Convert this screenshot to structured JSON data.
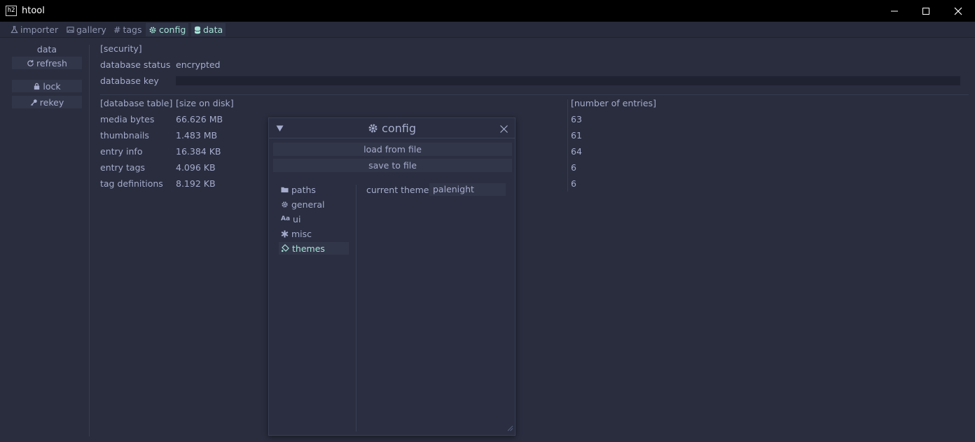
{
  "window": {
    "icon_text": "h2",
    "title": "htool"
  },
  "tabs": [
    {
      "label": "importer",
      "icon": "flask-icon"
    },
    {
      "label": "gallery",
      "icon": "image-icon"
    },
    {
      "label": "tags",
      "icon": "hash-icon"
    },
    {
      "label": "config",
      "icon": "gear-icon"
    },
    {
      "label": "data",
      "icon": "database-icon"
    }
  ],
  "sidebar": {
    "title": "data",
    "refresh_label": "refresh",
    "lock_label": "lock",
    "rekey_label": "rekey"
  },
  "security": {
    "header": "[security]",
    "status_label": "database status",
    "status_value": "encrypted",
    "key_label": "database key",
    "key_value": ""
  },
  "table": {
    "headers": [
      "[database table]",
      "[size on disk]",
      "[number of entries]"
    ],
    "rows": [
      {
        "name": "media bytes",
        "size": "66.626 MB",
        "count": "63"
      },
      {
        "name": "thumbnails",
        "size": "1.483 MB",
        "count": "61"
      },
      {
        "name": "entry info",
        "size": "16.384 KB",
        "count": "64"
      },
      {
        "name": "entry tags",
        "size": "4.096 KB",
        "count": "6"
      },
      {
        "name": "tag definitions",
        "size": "8.192 KB",
        "count": "6"
      }
    ]
  },
  "config_window": {
    "title": "config",
    "load_label": "load from file",
    "save_label": "save to file",
    "nav": [
      {
        "label": "paths",
        "icon": "folder-icon"
      },
      {
        "label": "general",
        "icon": "gear-icon"
      },
      {
        "label": "ui",
        "icon": "font-icon"
      },
      {
        "label": "misc",
        "icon": "asterisk-icon"
      },
      {
        "label": "themes",
        "icon": "brush-icon"
      }
    ],
    "active_nav": "themes",
    "theme_label": "current theme",
    "theme_value": "palenight"
  },
  "colors": {
    "background": "#292d3e",
    "text": "#a6accd",
    "accent": "#a6e3d8",
    "button": "#323649",
    "titlebar": "#000000"
  }
}
